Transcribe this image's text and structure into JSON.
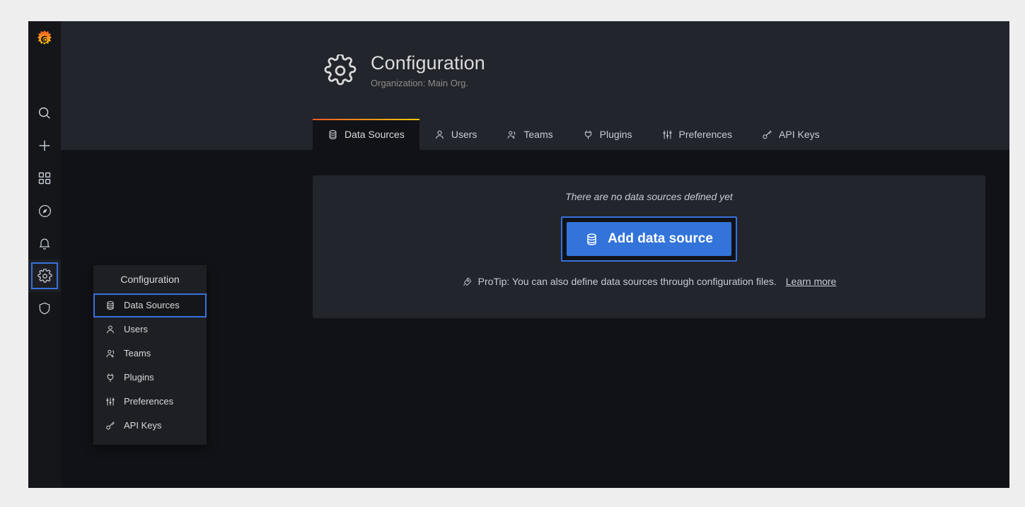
{
  "app": {
    "brand_icon": "grafana-logo"
  },
  "sidebar": {
    "items": [
      {
        "icon": "search-icon",
        "name": "search"
      },
      {
        "icon": "plus-icon",
        "name": "create"
      },
      {
        "icon": "dashboards-icon",
        "name": "dashboards"
      },
      {
        "icon": "compass-icon",
        "name": "explore"
      },
      {
        "icon": "bell-icon",
        "name": "alerting"
      },
      {
        "icon": "gear-icon",
        "name": "configuration",
        "focused": true
      },
      {
        "icon": "shield-icon",
        "name": "server-admin"
      }
    ]
  },
  "header": {
    "icon": "gear-icon",
    "title": "Configuration",
    "subtitle": "Organization: Main Org."
  },
  "tabs": [
    {
      "label": "Data Sources",
      "icon": "database-icon",
      "active": true
    },
    {
      "label": "Users",
      "icon": "user-icon",
      "active": false
    },
    {
      "label": "Teams",
      "icon": "users-icon",
      "active": false
    },
    {
      "label": "Plugins",
      "icon": "plug-icon",
      "active": false
    },
    {
      "label": "Preferences",
      "icon": "sliders-icon",
      "active": false
    },
    {
      "label": "API Keys",
      "icon": "key-icon",
      "active": false
    }
  ],
  "content": {
    "empty_message": "There are no data sources defined yet",
    "add_button_label": "Add data source",
    "add_button_icon": "database-icon",
    "protip_icon": "rocket-icon",
    "protip_text": "ProTip: You can also define data sources through configuration files.",
    "protip_link": "Learn more"
  },
  "dropdown": {
    "title": "Configuration",
    "items": [
      {
        "label": "Data Sources",
        "icon": "database-icon",
        "focused": true
      },
      {
        "label": "Users",
        "icon": "user-icon",
        "focused": false
      },
      {
        "label": "Teams",
        "icon": "users-icon",
        "focused": false
      },
      {
        "label": "Plugins",
        "icon": "plug-icon",
        "focused": false
      },
      {
        "label": "Preferences",
        "icon": "sliders-icon",
        "focused": false
      },
      {
        "label": "API Keys",
        "icon": "key-icon",
        "focused": false
      }
    ]
  },
  "colors": {
    "accent_blue": "#3274d9",
    "focus_blue": "#3871dc",
    "brand_orange": "#f05a28",
    "brand_yellow": "#fbca0a",
    "panel_bg": "#22252b",
    "page_bg": "#111217"
  }
}
